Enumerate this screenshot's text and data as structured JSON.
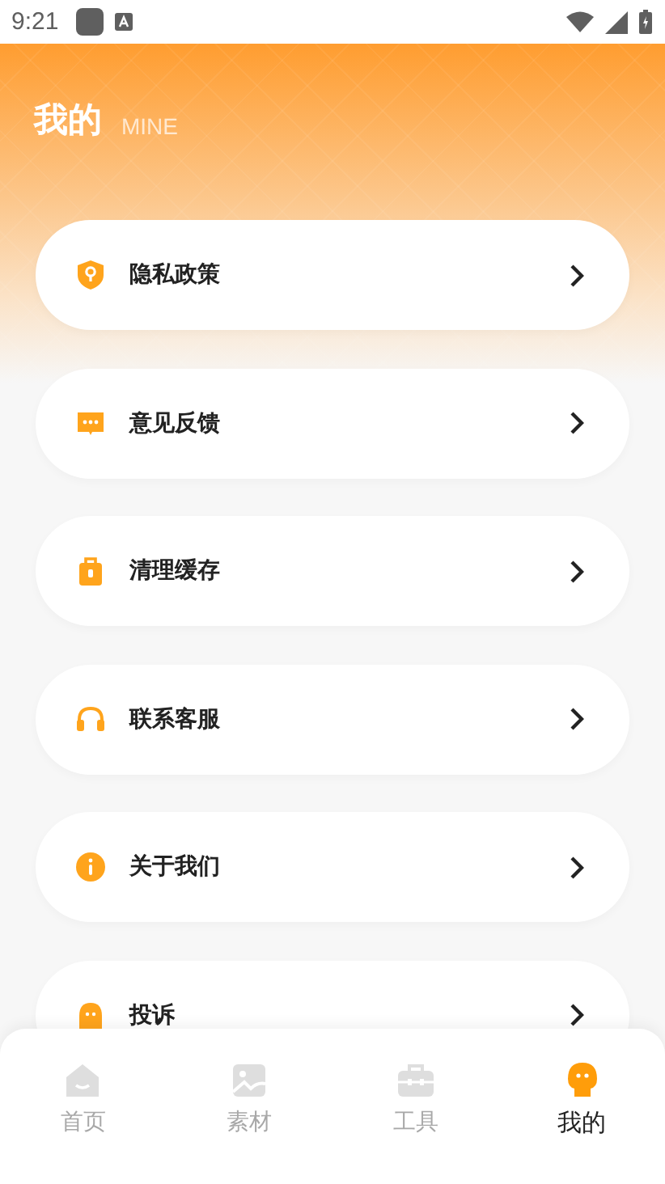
{
  "status_bar": {
    "time": "9:21"
  },
  "header": {
    "title": "我的",
    "subtitle": "MINE"
  },
  "menu": [
    {
      "label": "隐私政策"
    },
    {
      "label": "意见反馈"
    },
    {
      "label": "清理缓存"
    },
    {
      "label": "联系客服"
    },
    {
      "label": "关于我们"
    },
    {
      "label": "投诉"
    }
  ],
  "tabs": [
    {
      "label": "首页",
      "selected": false
    },
    {
      "label": "素材",
      "selected": false
    },
    {
      "label": "工具",
      "selected": false
    },
    {
      "label": "我的",
      "selected": true
    }
  ]
}
